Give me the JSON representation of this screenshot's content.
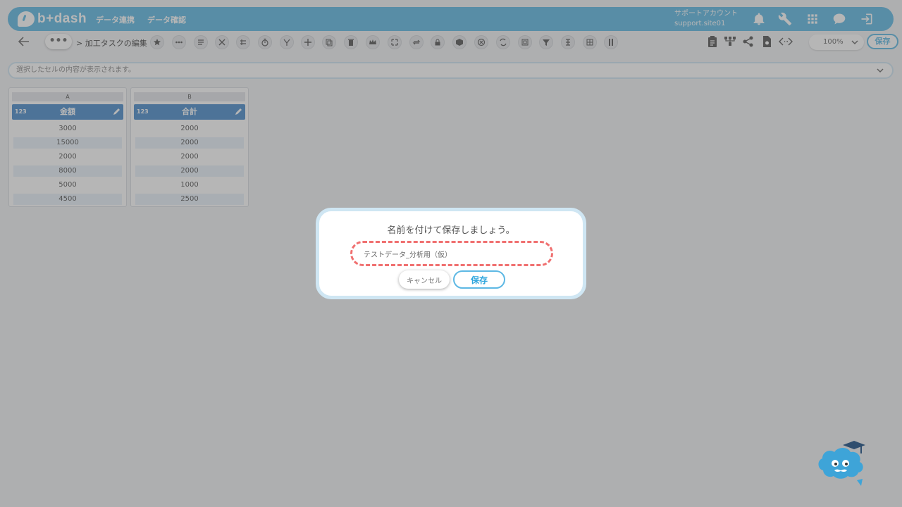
{
  "header": {
    "brand": "b+dash",
    "nav": [
      "データ連携",
      "データ確認"
    ],
    "account_name": "サポートアカウント",
    "account_id": "support.site01"
  },
  "toolbar": {
    "more": "•••",
    "breadcrumb": "> 加工タスクの編集",
    "zoom": "100%",
    "save_label": "保存"
  },
  "cell_info": {
    "placeholder": "選択したセルの内容が表示されます。"
  },
  "columns": [
    {
      "letter": "A",
      "type": "123",
      "name": "金額",
      "values": [
        "3000",
        "15000",
        "2000",
        "8000",
        "5000",
        "4500"
      ]
    },
    {
      "letter": "B",
      "type": "123",
      "name": "合計",
      "values": [
        "2000",
        "2000",
        "2000",
        "2000",
        "1000",
        "2500"
      ]
    }
  ],
  "dialog": {
    "title": "名前を付けて保存しましょう。",
    "name_value": "テストデータ_分析用（仮）",
    "cancel_label": "キャンセル",
    "save_label": "保存"
  },
  "colors": {
    "accent": "#5db8e4",
    "column_header": "#4a8ccc",
    "highlight": "#f07070"
  }
}
